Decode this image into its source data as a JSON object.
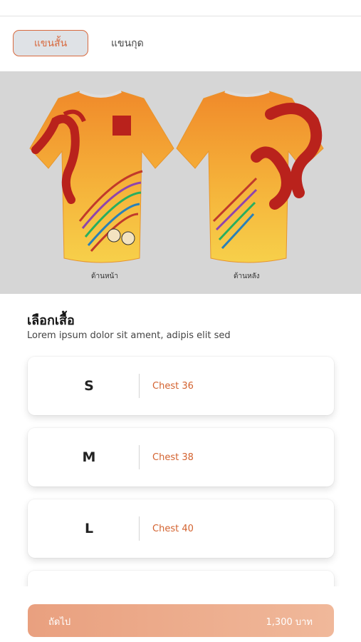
{
  "tabs": {
    "active": "แขนสั้น",
    "inactive": "แขนกุด"
  },
  "preview": {
    "front_caption": "ด้านหน้า",
    "back_caption": "ด้านหลัง"
  },
  "section": {
    "title": "เลือกเสื้อ",
    "subtitle": "Lorem ipsum dolor sit ament, adipis elit sed"
  },
  "sizes": [
    {
      "size": "S",
      "chest": "Chest 36"
    },
    {
      "size": "M",
      "chest": "Chest 38"
    },
    {
      "size": "L",
      "chest": "Chest 40"
    },
    {
      "size": "",
      "chest": ""
    }
  ],
  "footer": {
    "next_label": "ถัดไป",
    "price": "1,300 บาท"
  },
  "colors": {
    "accent": "#d86a3f",
    "button": "#eba888",
    "shirt": "#f2a033",
    "dragon": "#b9221c"
  }
}
